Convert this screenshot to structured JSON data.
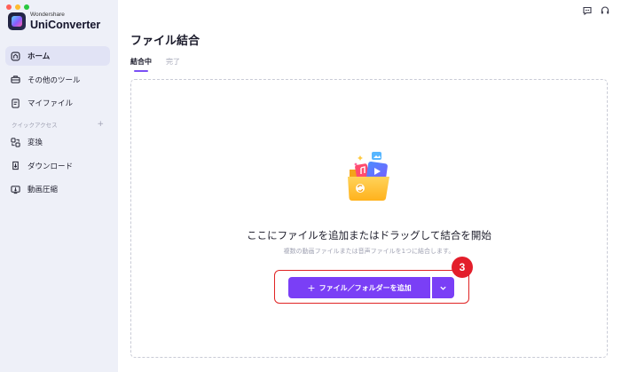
{
  "app": {
    "brand_small": "Wondershare",
    "brand_name": "UniConverter"
  },
  "sidebar": {
    "items": [
      {
        "label": "ホーム",
        "icon": "home-icon"
      },
      {
        "label": "その他のツール",
        "icon": "toolbox-icon"
      },
      {
        "label": "マイファイル",
        "icon": "file-icon"
      }
    ],
    "quick_access_label": "クイックアクセス",
    "quick_access_add": "+",
    "quick_items": [
      {
        "label": "変換",
        "icon": "convert-icon"
      },
      {
        "label": "ダウンロード",
        "icon": "download-icon"
      },
      {
        "label": "動画圧縮",
        "icon": "compress-icon"
      }
    ]
  },
  "header": {
    "title": "ファイル結合",
    "icons": [
      "avatar-icon",
      "chat-icon",
      "support-headset-icon"
    ]
  },
  "tabs": [
    {
      "label": "結合中",
      "active": true
    },
    {
      "label": "完了",
      "active": false
    }
  ],
  "dropzone": {
    "title": "ここにファイルを追加またはドラッグして結合を開始",
    "subtitle": "複数の動画ファイルまたは音声ファイルを1つに結合します。",
    "add_button_label": "ファイル／フォルダーを追加",
    "add_button_prefix": "+",
    "dropdown_icon": "chevron-down-icon"
  },
  "annotation": {
    "step_number": "3"
  },
  "colors": {
    "accent": "#7a3ff6",
    "highlight": "#e02424",
    "sidebar_bg": "#eef0f8"
  }
}
